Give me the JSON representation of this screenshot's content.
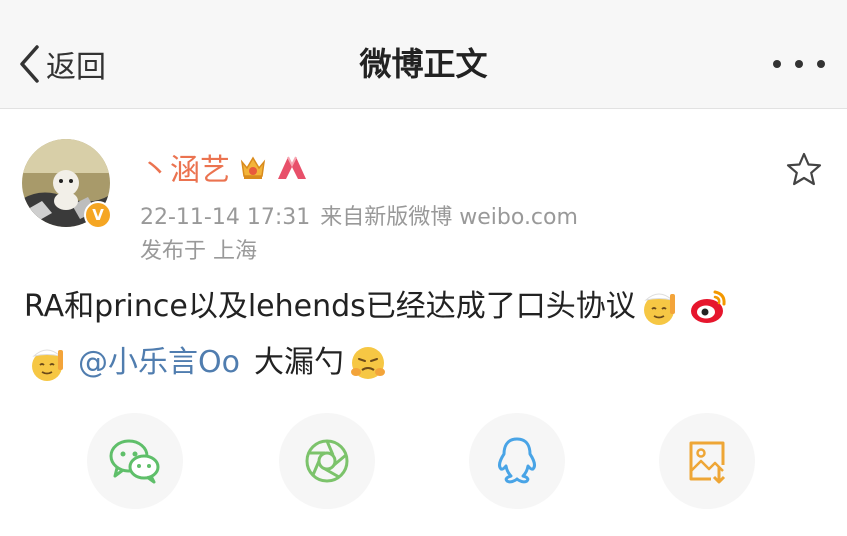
{
  "nav": {
    "back_label": "返回",
    "title": "微博正文"
  },
  "post": {
    "username": "丶涵艺",
    "time": "22-11-14 17:31",
    "source": "来自新版微博 weibo.com",
    "location": "发布于 上海",
    "text_line1": "RA和prince以及lehends已经达成了口头协议",
    "mention": "@小乐言Oo",
    "text_tail": "大漏勺"
  },
  "share": {
    "items": [
      "wechat-icon",
      "moments-icon",
      "qq-icon",
      "save-image-icon"
    ]
  },
  "colors": {
    "username": "#eb7350",
    "mention": "#507daf",
    "meta": "#999999",
    "wechat": "#5fbf6a",
    "moments": "#7cc36b",
    "qq": "#49a4e6",
    "save": "#eea636"
  }
}
